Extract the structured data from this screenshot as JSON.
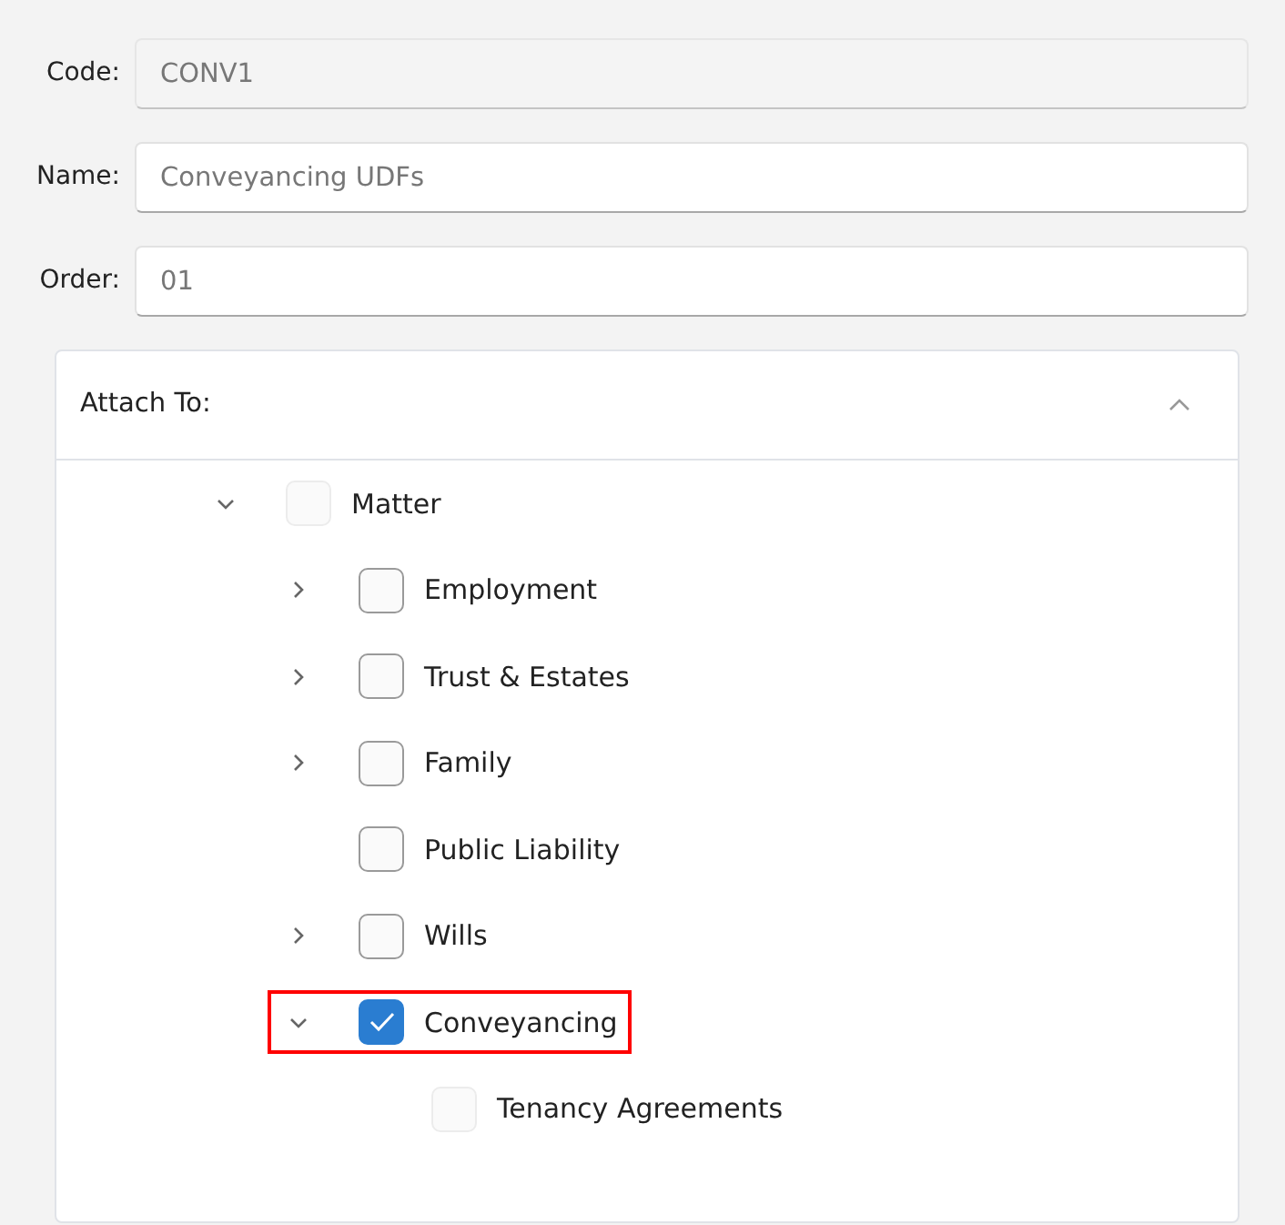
{
  "fields": [
    {
      "label": "Code:",
      "value": "CONV1",
      "disabled": true
    },
    {
      "label": "Name:",
      "value": "Conveyancing UDFs",
      "disabled": false
    },
    {
      "label": "Order:",
      "value": "01",
      "disabled": false
    }
  ],
  "attach_panel": {
    "title": "Attach To:",
    "expanded": true,
    "tree": [
      {
        "label": "Matter",
        "expandable": true,
        "expanded": true,
        "checked": false,
        "disabled": true,
        "highlighted": false,
        "children": [
          {
            "label": "Employment",
            "expandable": true,
            "expanded": false,
            "checked": false,
            "disabled": false,
            "highlighted": false
          },
          {
            "label": "Trust & Estates",
            "expandable": true,
            "expanded": false,
            "checked": false,
            "disabled": false,
            "highlighted": false
          },
          {
            "label": "Family",
            "expandable": true,
            "expanded": false,
            "checked": false,
            "disabled": false,
            "highlighted": false
          },
          {
            "label": "Public Liability",
            "expandable": false,
            "checked": false,
            "disabled": false,
            "highlighted": false
          },
          {
            "label": "Wills",
            "expandable": true,
            "expanded": false,
            "checked": false,
            "disabled": false,
            "highlighted": false
          },
          {
            "label": "Conveyancing",
            "expandable": true,
            "expanded": true,
            "checked": true,
            "disabled": false,
            "highlighted": true,
            "children": [
              {
                "label": "Tenancy Agreements",
                "expandable": false,
                "checked": false,
                "disabled": true,
                "highlighted": false
              }
            ]
          }
        ]
      }
    ]
  }
}
